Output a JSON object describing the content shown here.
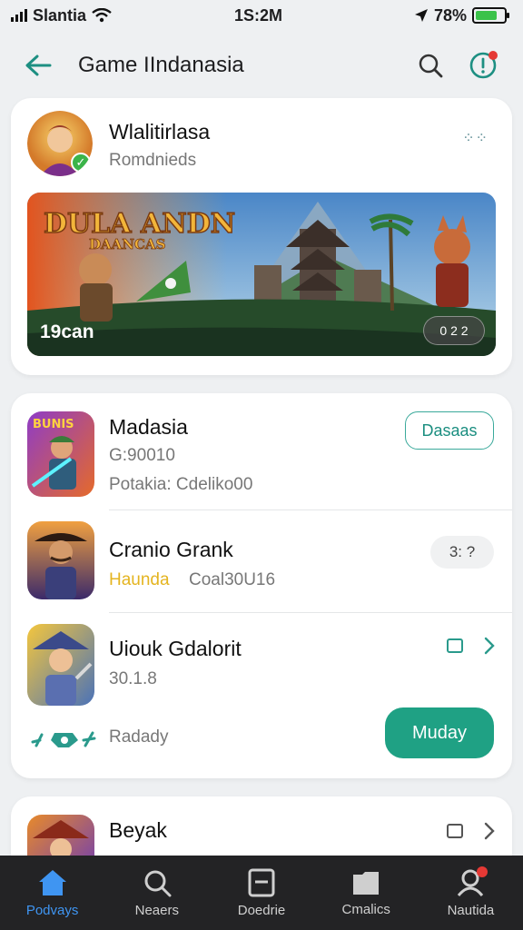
{
  "status_bar": {
    "carrier": "Slantia",
    "time": "1S:2M",
    "battery_text": "78%",
    "battery_level": 0.78
  },
  "header": {
    "title": "Game IIndanasia"
  },
  "featured": {
    "title": "Wlalitirlasa",
    "subtitle": "Romdnieds",
    "banner_logo_line1": "DULA ANDN",
    "banner_logo_line2": "DAANCAS",
    "banner_caption": "19can",
    "banner_pill": "0 2 2"
  },
  "list": [
    {
      "title": "Madasia",
      "line1": "G:90010",
      "line2": "Potakia: Cdeliko00",
      "action": "Dasaas"
    },
    {
      "title": "Cranio Grank",
      "tag": "Haunda",
      "line2": "Coal30U16",
      "action": "3: ?"
    },
    {
      "title": "Uiouk Gdalorit",
      "line1": "30.1.8",
      "footer": "Radady",
      "action": "Muday"
    }
  ],
  "partial_item": {
    "title": "Beyak"
  },
  "nav": [
    {
      "label": "Podvays",
      "icon": "home-icon"
    },
    {
      "label": "Neaers",
      "icon": "search-icon"
    },
    {
      "label": "Doedrie",
      "icon": "document-icon"
    },
    {
      "label": "Cmalics",
      "icon": "folder-icon"
    },
    {
      "label": "Nautida",
      "icon": "profile-icon"
    }
  ],
  "colors": {
    "accent": "#1fa184",
    "nav_active": "#3f95f2",
    "notification": "#e53935"
  }
}
